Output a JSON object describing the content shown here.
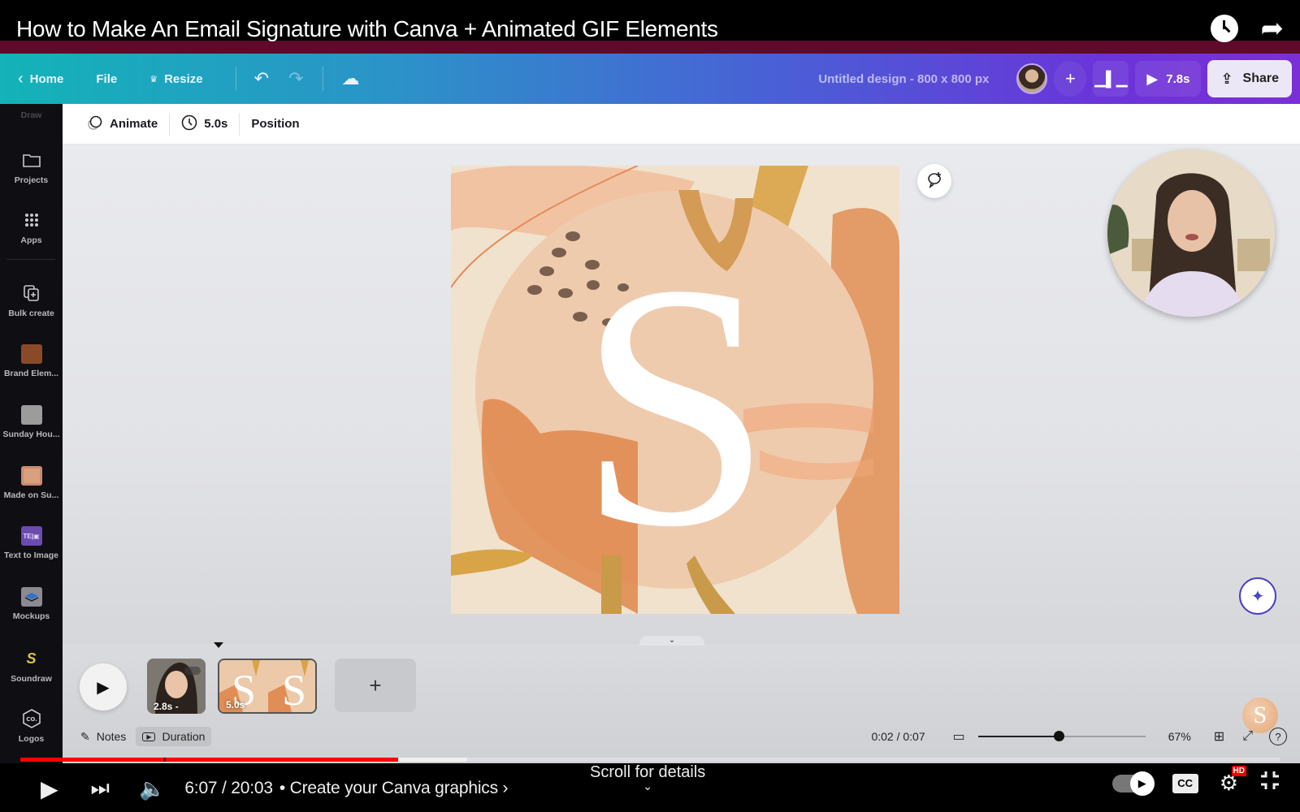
{
  "video": {
    "title": "How to Make An Email Signature with Canva + Animated GIF Elements",
    "current_time": "6:07",
    "duration": "20:03",
    "time_display": "6:07 / 20:03",
    "chapter": "• Create your Canva graphics ›",
    "scroll_hint": "Scroll for details",
    "progress_fraction": 0.3,
    "buffer_fraction": 0.355,
    "hd_badge": "HD",
    "cc_label": "CC",
    "icons": {
      "watch_later": "clock-icon",
      "share": "share-arrow-icon",
      "play": "play-icon",
      "next": "skip-next-icon",
      "volume": "volume-icon",
      "autoplay": "autoplay-toggle-icon",
      "captions": "cc-icon",
      "settings": "gear-icon",
      "exit_fullscreen": "exit-fullscreen-icon"
    }
  },
  "header": {
    "home_label": "Home",
    "file_label": "File",
    "resize_label": "Resize",
    "design_title": "Untitled design - 800 x 800 px",
    "play_duration": "7.8s",
    "share_label": "Share"
  },
  "sidebar": {
    "items": [
      {
        "label": "Draw"
      },
      {
        "label": "Projects"
      },
      {
        "label": "Apps"
      },
      {
        "label": "Bulk create"
      },
      {
        "label": "Brand Elem...",
        "color": "#8a4a28"
      },
      {
        "label": "Sunday Hou...",
        "color": "#9c9c9c"
      },
      {
        "label": "Made on Su...",
        "color": "#d9a07f"
      },
      {
        "label": "Text to Image",
        "color": "#6c4bb0"
      },
      {
        "label": "Mockups",
        "color": "#8a8a90"
      },
      {
        "label": "Soundraw",
        "color": "#d6c64a"
      },
      {
        "label": "Logos"
      }
    ]
  },
  "toolbar": {
    "animate_label": "Animate",
    "duration_label": "5.0s",
    "position_label": "Position"
  },
  "design": {
    "letter": "S",
    "colors": {
      "background": "#f1e3cf",
      "circle": "#efc9ab",
      "orange": "#e08e55",
      "mustard": "#d8a447",
      "dots": "#7a5f4d"
    }
  },
  "timeline": {
    "clips": [
      {
        "label": "2.8s -"
      },
      {
        "label": "5.0s"
      }
    ],
    "add_page_label": "+",
    "notes_label": "Notes",
    "duration_label": "Duration",
    "time": "0:02 / 0:07",
    "zoom_percent": "67%",
    "zoom_slider_fraction": 0.48
  }
}
